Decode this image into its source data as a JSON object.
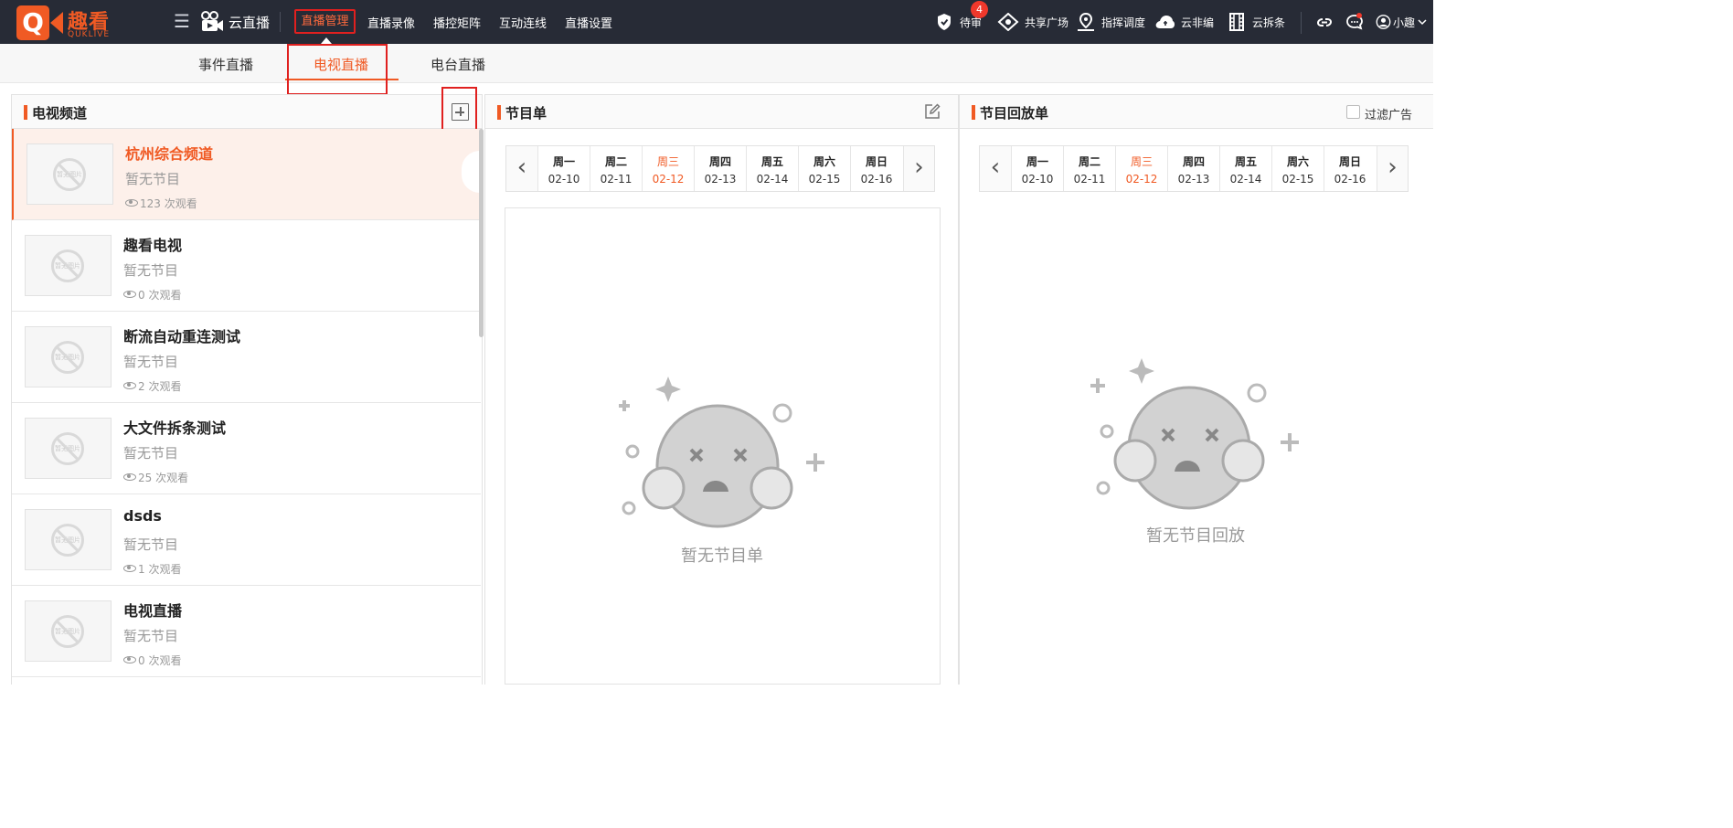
{
  "app": {
    "logo_letter": "Q",
    "logo_name": "趣看",
    "logo_sub": "QUKLIVE",
    "brand": "云直播"
  },
  "topnav": {
    "items": [
      "直播管理",
      "直播录像",
      "播控矩阵",
      "互动连线",
      "直播设置"
    ],
    "active": "直播管理"
  },
  "topright": {
    "pending": {
      "label": "待审",
      "badge": "4"
    },
    "share": "共享广场",
    "dispatch": "指挥调度",
    "cloud_edit": "云非编",
    "cloud_split": "云拆条",
    "user": "小趣"
  },
  "subnav": {
    "tabs": [
      "事件直播",
      "电视直播",
      "电台直播"
    ],
    "active": "电视直播"
  },
  "channels_panel": {
    "title": "电视频道",
    "thumb_placeholder": "暂无图片",
    "channels": [
      {
        "name": "杭州综合频道",
        "program": "暂无节目",
        "views": "123 次观看",
        "active": true
      },
      {
        "name": "趣看电视",
        "program": "暂无节目",
        "views": "0 次观看",
        "active": false
      },
      {
        "name": "断流自动重连测试",
        "program": "暂无节目",
        "views": "2 次观看",
        "active": false
      },
      {
        "name": "大文件拆条测试",
        "program": "暂无节目",
        "views": "25 次观看",
        "active": false
      },
      {
        "name": "dsds",
        "program": "暂无节目",
        "views": "1 次观看",
        "active": false
      },
      {
        "name": "电视直播",
        "program": "暂无节目",
        "views": "0 次观看",
        "active": false
      }
    ]
  },
  "days": [
    {
      "weekday": "周一",
      "date": "02-10"
    },
    {
      "weekday": "周二",
      "date": "02-11"
    },
    {
      "weekday": "周三",
      "date": "02-12",
      "today": true
    },
    {
      "weekday": "周四",
      "date": "02-13"
    },
    {
      "weekday": "周五",
      "date": "02-14"
    },
    {
      "weekday": "周六",
      "date": "02-15"
    },
    {
      "weekday": "周日",
      "date": "02-16"
    }
  ],
  "schedule_panel": {
    "title": "节目单",
    "empty_text": "暂无节目单"
  },
  "replay_panel": {
    "title": "节目回放单",
    "filter_label": "过滤广告",
    "empty_text": "暂无节目回放"
  },
  "colors": {
    "accent": "#f05a24",
    "topbar": "#272b36",
    "highlight_border": "#e0201f"
  }
}
